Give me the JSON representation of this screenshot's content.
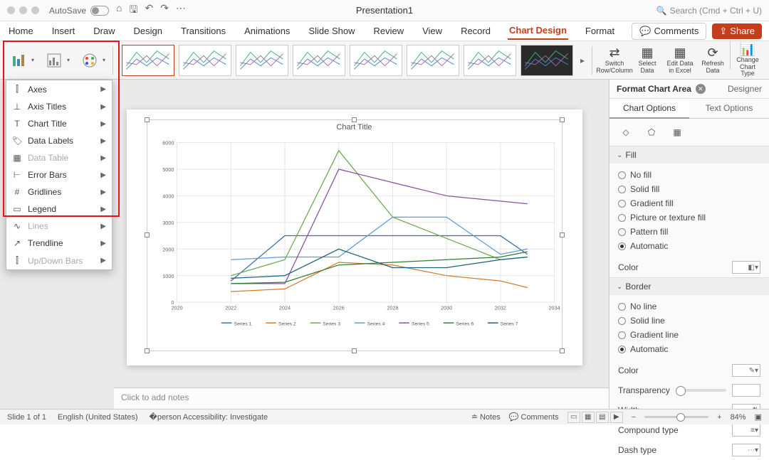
{
  "titlebar": {
    "autosave": "AutoSave",
    "doc_title": "Presentation1",
    "search_placeholder": "Search (Cmd + Ctrl + U)"
  },
  "ribbon_tabs": [
    "Home",
    "Insert",
    "Draw",
    "Design",
    "Transitions",
    "Animations",
    "Slide Show",
    "Review",
    "View",
    "Record",
    "Chart Design",
    "Format"
  ],
  "ribbon_active_index": 10,
  "ribbon_right": {
    "comments": "Comments",
    "share": "Share"
  },
  "ribbon_tools": {
    "switch": "Switch Row/Column",
    "select": "Select Data",
    "edit": "Edit Data in Excel",
    "refresh": "Refresh Data",
    "change": "Change Chart Type"
  },
  "add_element_menu": [
    {
      "label": "Axes",
      "enabled": true
    },
    {
      "label": "Axis Titles",
      "enabled": true
    },
    {
      "label": "Chart Title",
      "enabled": true
    },
    {
      "label": "Data Labels",
      "enabled": true
    },
    {
      "label": "Data Table",
      "enabled": false
    },
    {
      "label": "Error Bars",
      "enabled": true
    },
    {
      "label": "Gridlines",
      "enabled": true
    },
    {
      "label": "Legend",
      "enabled": true
    },
    {
      "label": "Lines",
      "enabled": false
    },
    {
      "label": "Trendline",
      "enabled": true
    },
    {
      "label": "Up/Down Bars",
      "enabled": false
    }
  ],
  "chart_data": {
    "type": "line",
    "title": "Chart Title",
    "xlabel": "",
    "ylabel": "",
    "x": [
      2020,
      2022,
      2024,
      2026,
      2028,
      2030,
      2032,
      2034
    ],
    "xlim": [
      2020,
      2034
    ],
    "ylim": [
      0,
      6000
    ],
    "y_ticks": [
      0,
      1000,
      2000,
      3000,
      4000,
      5000,
      6000
    ],
    "series": [
      {
        "name": "Series 1",
        "color": "#3b6ea5",
        "values": [
          null,
          800,
          2500,
          2500,
          2500,
          2500,
          2500,
          1800,
          null
        ]
      },
      {
        "name": "Series 2",
        "color": "#d77a2a",
        "values": [
          null,
          400,
          500,
          1500,
          1400,
          1000,
          800,
          550,
          null
        ]
      },
      {
        "name": "Series 3",
        "color": "#6aa84f",
        "values": [
          null,
          1000,
          1600,
          5700,
          3200,
          2400,
          1600,
          1700,
          null
        ]
      },
      {
        "name": "Series 4",
        "color": "#5b9bd5",
        "values": [
          null,
          1600,
          1700,
          1700,
          3200,
          3200,
          1800,
          2000,
          null
        ]
      },
      {
        "name": "Series 5",
        "color": "#884ea0",
        "values": [
          null,
          700,
          700,
          5000,
          4500,
          4000,
          3800,
          3700,
          null
        ]
      },
      {
        "name": "Series 6",
        "color": "#2e7d32",
        "values": [
          null,
          700,
          750,
          1400,
          1500,
          1600,
          1700,
          1900,
          null
        ]
      },
      {
        "name": "Series 7",
        "color": "#17617a",
        "values": [
          null,
          900,
          1000,
          2000,
          1300,
          1300,
          1600,
          1700,
          null
        ]
      }
    ],
    "legend_position": "bottom"
  },
  "notes_placeholder": "Click to add notes",
  "format_pane": {
    "title": "Format Chart Area",
    "designer": "Designer",
    "tabs": [
      "Chart Options",
      "Text Options"
    ],
    "active_tab": 0,
    "sections": {
      "fill": {
        "title": "Fill",
        "options": [
          "No fill",
          "Solid fill",
          "Gradient fill",
          "Picture or texture fill",
          "Pattern fill",
          "Automatic"
        ],
        "selected": 5,
        "color_label": "Color"
      },
      "border": {
        "title": "Border",
        "options": [
          "No line",
          "Solid line",
          "Gradient line",
          "Automatic"
        ],
        "selected": 3,
        "color_label": "Color",
        "transparency": "Transparency",
        "width": "Width",
        "compound": "Compound type",
        "dash": "Dash type"
      }
    }
  },
  "status": {
    "slide": "Slide 1 of 1",
    "lang": "English (United States)",
    "access": "Accessibility: Investigate",
    "notes": "Notes",
    "comments": "Comments",
    "zoom": "84%"
  }
}
